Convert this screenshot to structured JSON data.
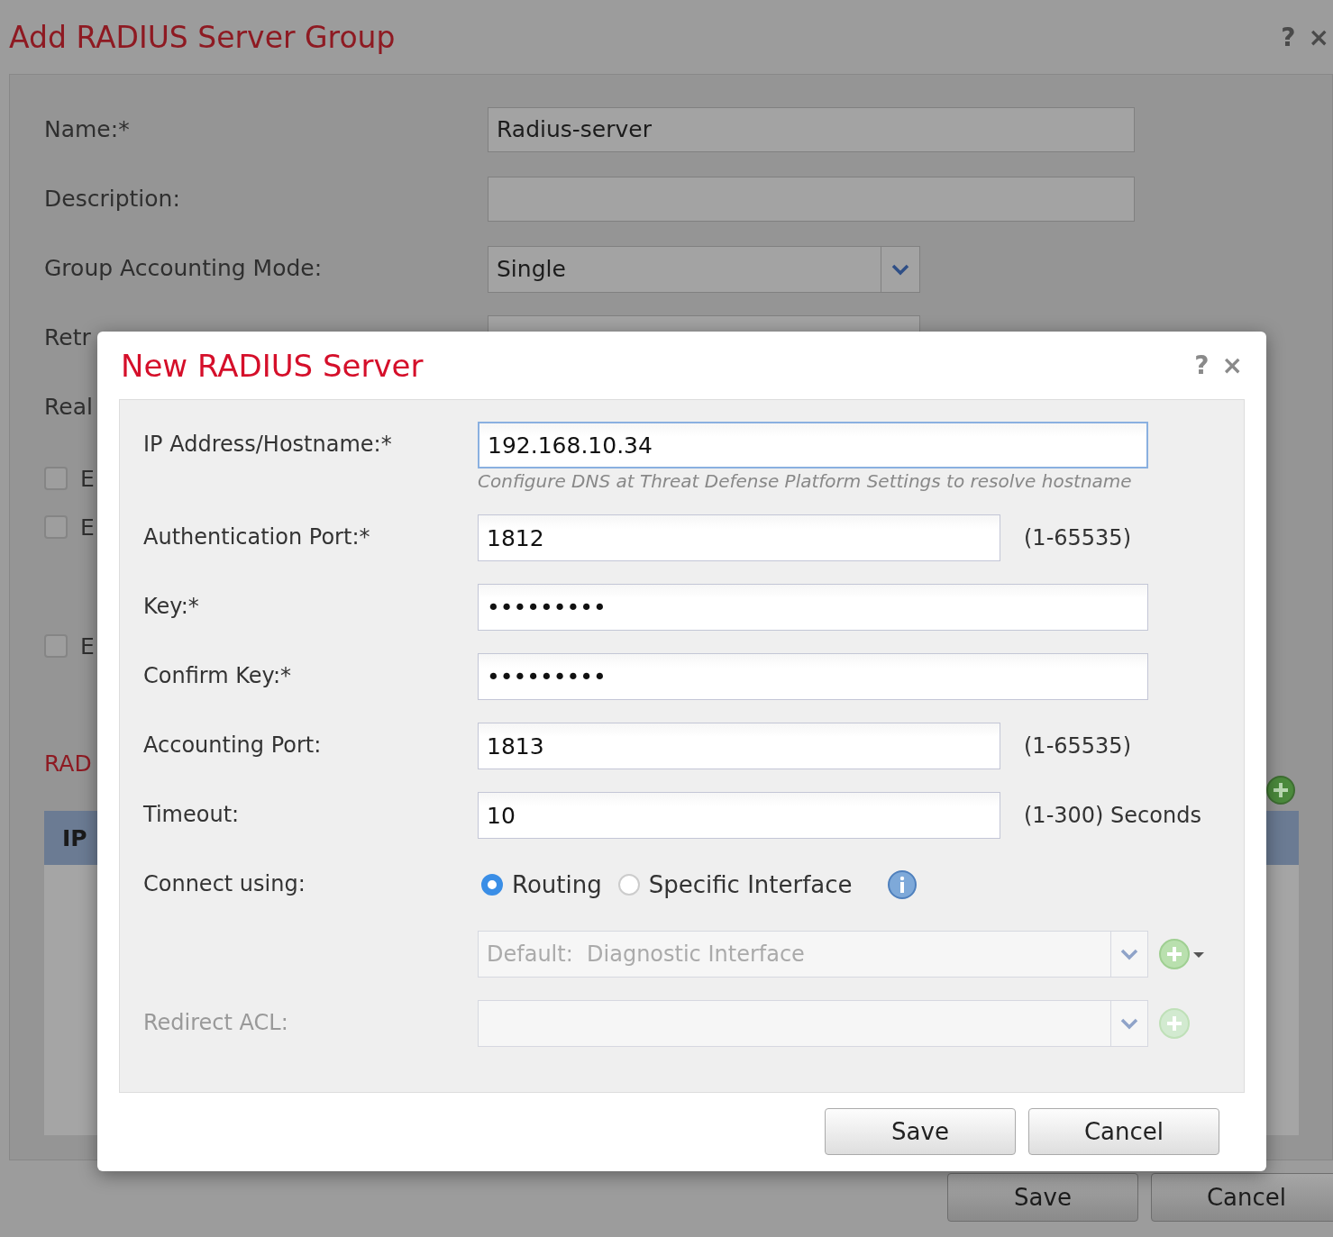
{
  "background_dialog": {
    "title": "Add RADIUS Server Group",
    "help": "?",
    "close": "×",
    "fields": [
      {
        "label": "Name:*",
        "kind": "text",
        "value": "Radius-server"
      },
      {
        "label": "Description:",
        "kind": "text"
      },
      {
        "label": "Group Accounting Mode:",
        "kind": "select",
        "value": "Single"
      },
      {
        "label": "Retr",
        "kind": "covered"
      },
      {
        "label": "Real",
        "kind": "label"
      }
    ],
    "checkboxes": [
      {
        "label": "E",
        "checked": false
      },
      {
        "label": "E",
        "checked": false
      },
      {
        "label": "E",
        "checked": false
      }
    ],
    "section_title": "RAD",
    "table": {
      "columns": [
        "IP"
      ]
    },
    "buttons": [
      "Save",
      "Cancel"
    ]
  },
  "dialog": {
    "title": "New RADIUS Server",
    "help": "?",
    "close": "×",
    "fields": [
      {
        "label": "IP Address/Hostname:*",
        "kind": "text",
        "value": "192.168.10.34",
        "focused": true,
        "hint": "Configure DNS at Threat Defense Platform Settings to resolve hostname"
      },
      {
        "label": "Authentication Port:*",
        "kind": "short",
        "value": "1812",
        "suffix": "(1-65535)"
      },
      {
        "label": "Key:*",
        "kind": "text",
        "value": "•••••••••"
      },
      {
        "label": "Confirm Key:*",
        "kind": "text",
        "value": "•••••••••"
      },
      {
        "label": "Accounting Port:",
        "kind": "short",
        "value": "1813",
        "suffix": "(1-65535)"
      },
      {
        "label": "Timeout:",
        "kind": "short",
        "value": "10",
        "suffix": "(1-300) Seconds"
      },
      {
        "label": "Connect using:",
        "kind": "radio",
        "info": true,
        "options": [
          {
            "label": "Routing",
            "selected": true
          },
          {
            "label": "Specific Interface",
            "selected": false
          }
        ]
      },
      {
        "kind": "select",
        "disabled": true,
        "value": "Default:  Diagnostic Interface",
        "add_menu": true
      },
      {
        "label": "Redirect ACL:",
        "kind": "select",
        "disabled": true,
        "add_menu": false
      }
    ],
    "buttons": [
      "Save",
      "Cancel"
    ]
  }
}
